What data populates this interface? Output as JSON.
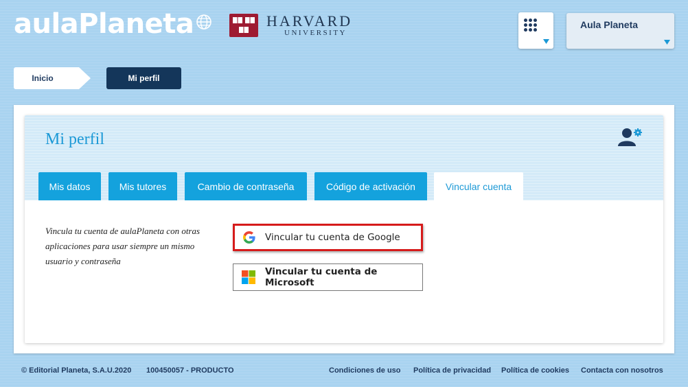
{
  "header": {
    "logo_text": "aulaPlaneta",
    "partner_name": "HARVARD",
    "partner_subtitle": "UNIVERSITY",
    "apps_icon": "grid-dots-icon",
    "user_name": "Aula Planeta"
  },
  "breadcrumb": {
    "home": "Inicio",
    "current": "Mi perfil"
  },
  "profile": {
    "title": "Mi perfil",
    "settings_icon": "user-settings-icon",
    "tabs": [
      {
        "label": "Mis datos",
        "active": false
      },
      {
        "label": "Mis tutores",
        "active": false
      },
      {
        "label": "Cambio de contraseña",
        "active": false
      },
      {
        "label": "Código de activación",
        "active": false
      },
      {
        "label": "Vincular cuenta",
        "active": true
      }
    ],
    "description": "Vincula tu cuenta de aulaPlaneta con otras aplicaciones para usar siempre un mismo usuario y contraseña",
    "google_button": "Vincular tu cuenta de Google",
    "microsoft_button": "Vincular tu cuenta de Microsoft"
  },
  "footer": {
    "copyright": "© Editorial Planeta, S.A.U.2020",
    "product": "100450057 - PRODUCTO",
    "links": [
      "Condiciones de uso",
      "Política de privacidad",
      "Política de cookies",
      "Contacta con nosotros"
    ]
  },
  "colors": {
    "background": "#a9d3f0",
    "navy": "#14365a",
    "tab_blue": "#14a2dd",
    "title_blue": "#1c99d6",
    "highlight_red": "#d61b1b"
  }
}
